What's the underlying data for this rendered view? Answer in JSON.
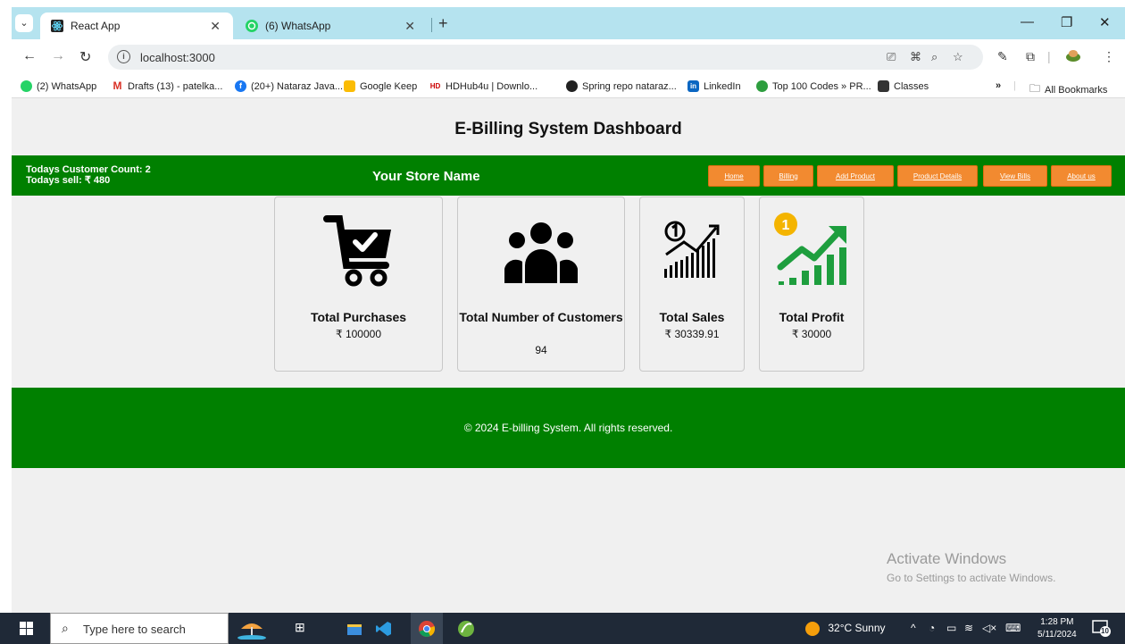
{
  "browser": {
    "tabs": [
      {
        "label": "React App",
        "active": true
      },
      {
        "label": "(6) WhatsApp",
        "active": false
      }
    ],
    "url": "localhost:3000",
    "bookmarks": [
      "(2) WhatsApp",
      "Drafts (13) - patelka...",
      "(20+) Nataraz Java...",
      "Google Keep",
      "HDHub4u | Downlo...",
      "Spring repo nataraz...",
      "LinkedIn",
      "Top 100 Codes » PR...",
      "Classes"
    ],
    "all_bookmarks": "All Bookmarks",
    "more": "»"
  },
  "page": {
    "title": "E-Billing System Dashboard",
    "store_bar": {
      "customer_count": "Todays Customer Count: 2",
      "todays_sell": "Todays sell: ₹ 480",
      "store_name": "Your Store Name",
      "nav": [
        "Home",
        "Billing",
        "Add Product",
        "Product Details",
        "View Bills",
        "About us"
      ]
    },
    "cards": [
      {
        "title": "Total Purchases",
        "value": "₹ 100000"
      },
      {
        "title": "Total Number of Customers",
        "value": "94"
      },
      {
        "title": "Total Sales",
        "value": "₹ 30339.91"
      },
      {
        "title": "Total Profit",
        "value": "₹ 30000"
      }
    ],
    "footer": "© 2024 E-billing System. All rights reserved.",
    "watermark": {
      "line1": "Activate Windows",
      "line2": "Go to Settings to activate Windows."
    }
  },
  "taskbar": {
    "search_placeholder": "Type here to search",
    "weather": "32°C  Sunny",
    "time": "1:28 PM",
    "date": "5/11/2024",
    "notification_count": "10"
  },
  "colors": {
    "green": "#008000",
    "orange": "#f28a30",
    "tab_bar": "#b5e3ef"
  }
}
